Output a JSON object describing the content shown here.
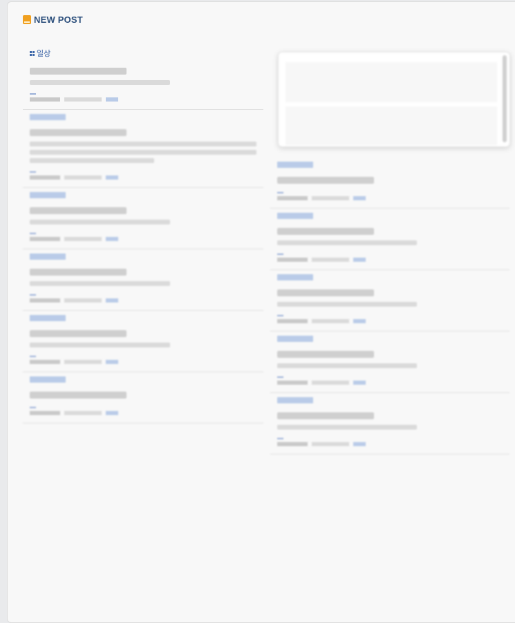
{
  "header": {
    "title": "NEW POST",
    "icon": "book-icon"
  },
  "left_posts": [
    {
      "category": "일상",
      "title": "",
      "lines": 1,
      "first": true
    },
    {
      "category": "",
      "title": "",
      "lines": 3
    },
    {
      "category": "",
      "title": "",
      "lines": 1
    },
    {
      "category": "",
      "title": "",
      "lines": 1
    },
    {
      "category": "",
      "title": "",
      "lines": 1
    },
    {
      "category": "",
      "title": "",
      "lines": 0
    }
  ],
  "right_posts": [
    {
      "category": "",
      "title": "",
      "lines": 0
    },
    {
      "category": "",
      "title": "",
      "lines": 1
    },
    {
      "category": "",
      "title": "",
      "lines": 1
    },
    {
      "category": "",
      "title": "",
      "lines": 1
    },
    {
      "category": "",
      "title": "",
      "lines": 1
    }
  ],
  "colors": {
    "accent": "#2c4f7c",
    "category": "#2f5aa0",
    "book": "#f0a020"
  }
}
